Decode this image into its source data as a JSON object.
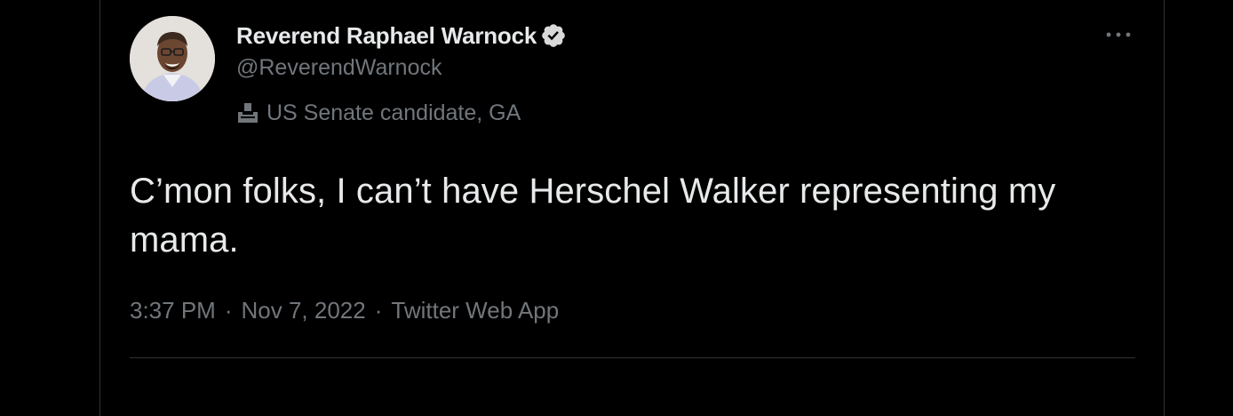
{
  "tweet": {
    "author": {
      "display_name": "Reverend Raphael Warnock",
      "handle": "@ReverendWarnock",
      "verified": true,
      "avatar_icon": "profile-photo",
      "label_icon": "ballot-box-icon",
      "label": "US Senate candidate, GA"
    },
    "more_icon": "more-options-icon",
    "text": "C’mon folks, I can’t have Herschel Walker representing my mama.",
    "time": "3:37 PM",
    "date": "Nov 7, 2022",
    "source": "Twitter Web App",
    "separator": "·"
  },
  "colors": {
    "background": "#000000",
    "primary_text": "#e7e9ea",
    "secondary_text": "#71767b",
    "border": "#2f3336",
    "verified_badge": "#d9d9d9"
  }
}
